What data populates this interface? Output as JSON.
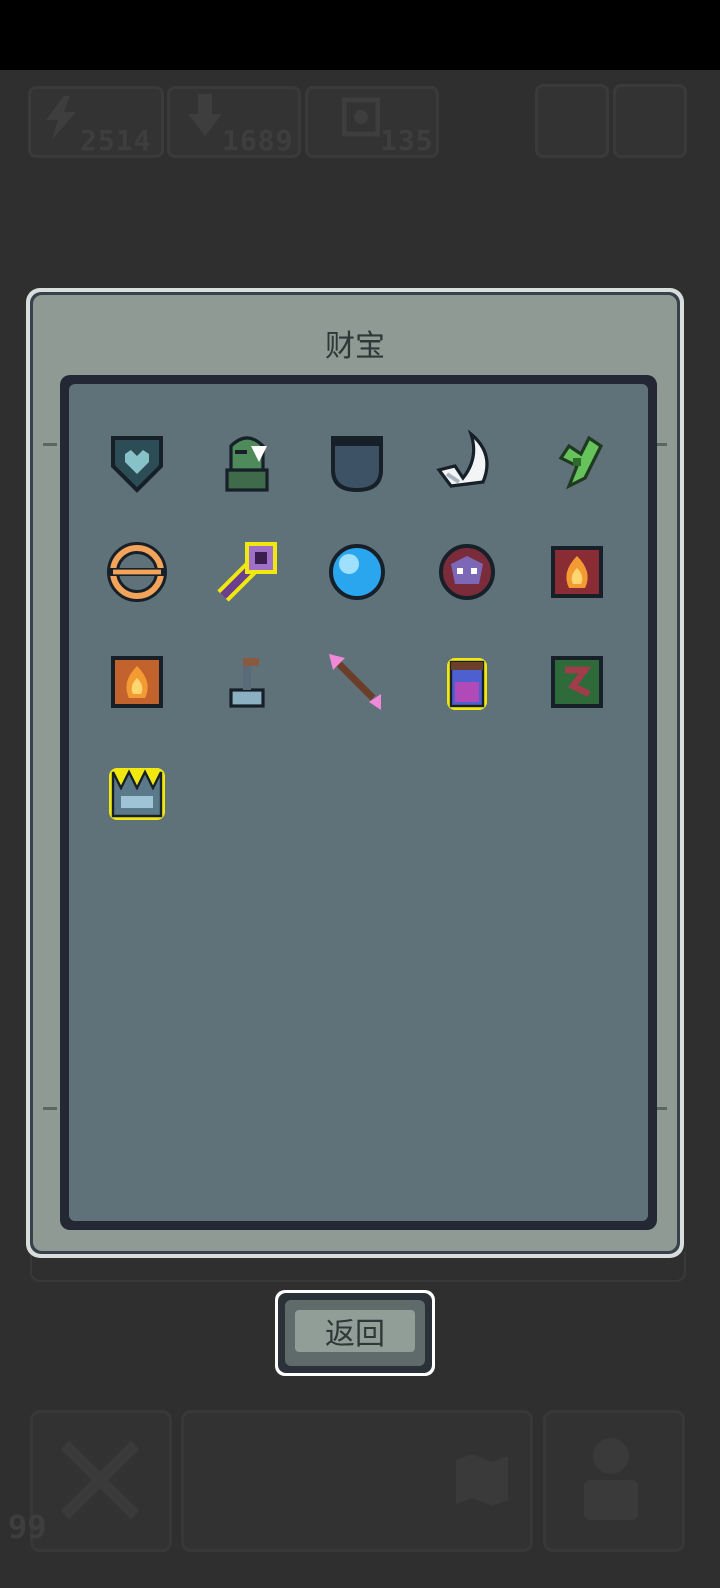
{
  "hud": {
    "energy": "2514",
    "download": "1689",
    "gear": "135"
  },
  "modal": {
    "title": "财宝"
  },
  "treasures": [
    {
      "icon": "heart-shield-icon"
    },
    {
      "icon": "green-knight-icon"
    },
    {
      "icon": "pocket-shield-icon"
    },
    {
      "icon": "white-wing-icon"
    },
    {
      "icon": "green-sprout-icon"
    },
    {
      "icon": "orange-ring-icon"
    },
    {
      "icon": "purple-key-icon"
    },
    {
      "icon": "blue-orb-icon"
    },
    {
      "icon": "purple-demon-icon"
    },
    {
      "icon": "fire-book-red-icon"
    },
    {
      "icon": "fire-book-orange-icon"
    },
    {
      "icon": "pipe-lever-icon"
    },
    {
      "icon": "pink-arrow-icon"
    },
    {
      "icon": "purple-potion-jar-icon"
    },
    {
      "icon": "green-rune-tile-icon"
    },
    {
      "icon": "blue-crown-icon"
    }
  ],
  "back_button": {
    "label": "返回"
  },
  "bottom_bar": {
    "count": "99"
  },
  "colors": {
    "panel": "#8f9a94",
    "well": "#5f7279",
    "highlight": "#f1e80f"
  }
}
